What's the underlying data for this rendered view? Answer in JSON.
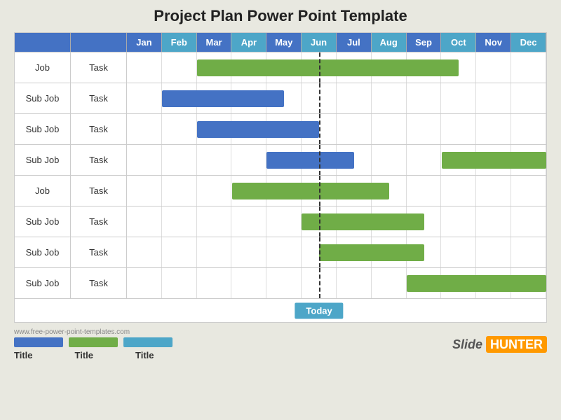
{
  "title": "Project Plan Power Point Template",
  "months": [
    "Jan",
    "Feb",
    "Mar",
    "Apr",
    "May",
    "Jun",
    "Jul",
    "Aug",
    "Sep",
    "Oct",
    "Nov",
    "Dec"
  ],
  "rows": [
    {
      "job": "Job",
      "task": "Task",
      "bars": [
        {
          "color": "green",
          "start": 2,
          "end": 9.5
        }
      ]
    },
    {
      "job": "Sub Job",
      "task": "Task",
      "bars": [
        {
          "color": "blue",
          "start": 1,
          "end": 4.5
        }
      ]
    },
    {
      "job": "Sub Job",
      "task": "Task",
      "bars": [
        {
          "color": "blue",
          "start": 2,
          "end": 5.5
        }
      ]
    },
    {
      "job": "Sub Job",
      "task": "Task",
      "bars": [
        {
          "color": "blue",
          "start": 4,
          "end": 6.5
        },
        {
          "color": "green",
          "start": 9,
          "end": 12
        }
      ]
    },
    {
      "job": "Job",
      "task": "Task",
      "bars": [
        {
          "color": "green",
          "start": 3,
          "end": 7.5
        }
      ]
    },
    {
      "job": "Sub Job",
      "task": "Task",
      "bars": [
        {
          "color": "green",
          "start": 5,
          "end": 8.5
        }
      ]
    },
    {
      "job": "Sub Job",
      "task": "Task",
      "bars": [
        {
          "color": "green",
          "start": 5.5,
          "end": 8.5
        }
      ]
    },
    {
      "job": "Sub Job",
      "task": "Task",
      "bars": [
        {
          "color": "green",
          "start": 8,
          "end": 12
        }
      ]
    }
  ],
  "today_col": 5.5,
  "today_label": "Today",
  "footer": {
    "url": "www.free-power-point-templates.com",
    "titles": [
      "Title",
      "Title",
      "Title"
    ],
    "brand": {
      "slide": "Slide",
      "hunter": "HUNTER"
    }
  }
}
